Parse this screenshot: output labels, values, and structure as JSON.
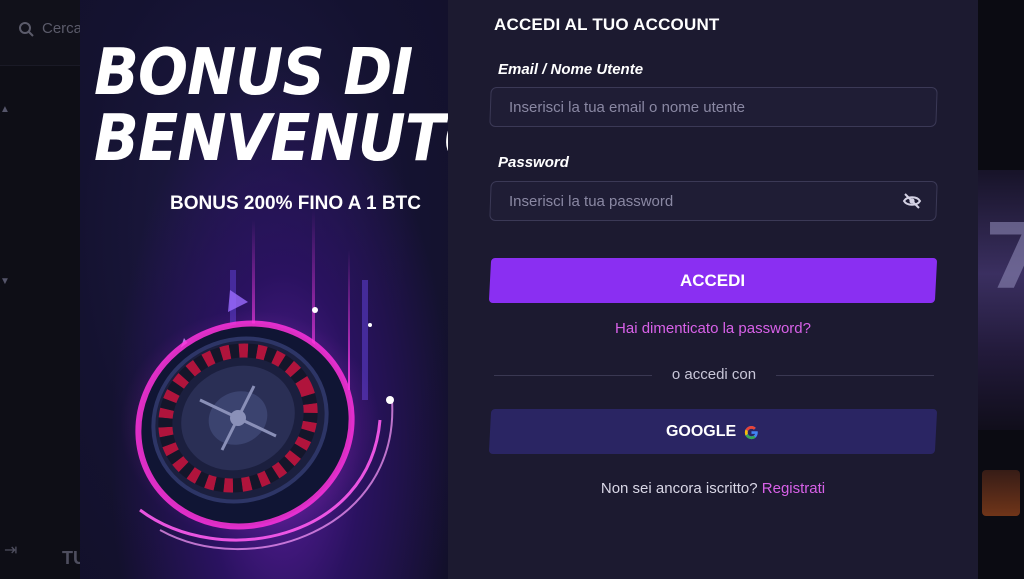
{
  "background": {
    "search_placeholder": "Cerca",
    "bottom_label": "TU"
  },
  "promo": {
    "title_line1": "BONUS DI",
    "title_line2": "BENVENUTO",
    "subtitle": "BONUS 200% FINO A 1 BTC"
  },
  "form": {
    "title": "ACCEDI AL TUO ACCOUNT",
    "email_label": "Email / Nome Utente",
    "email_placeholder": "Inserisci la tua email o nome utente",
    "email_value": "",
    "password_label": "Password",
    "password_placeholder": "Inserisci la tua password",
    "password_value": "",
    "submit_label": "ACCEDI",
    "forgot_label": "Hai dimenticato la password?",
    "divider_text": "o accedi con",
    "google_label": "GOOGLE",
    "signup_text": "Non sei ancora iscritto?",
    "signup_link": "Registrati"
  },
  "colors": {
    "accent": "#8a2ff2",
    "link": "#d861e8",
    "google_button": "#2a2563",
    "modal_bg": "#1c1a30"
  },
  "icons": {
    "search": "search-icon",
    "password_toggle": "eye-off-icon",
    "google": "google-g-icon"
  }
}
